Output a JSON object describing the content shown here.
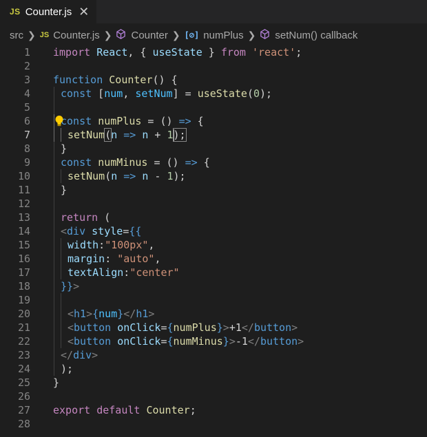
{
  "tab": {
    "badge": "JS",
    "filename": "Counter.js",
    "close": "✕"
  },
  "breadcrumb": {
    "folder": "src",
    "file_badge": "JS",
    "file": "Counter.js",
    "component": "Counter",
    "var_badge": "[⊘]",
    "variable": "numPlus",
    "callback": "setNum() callback"
  },
  "line_numbers": [
    "1",
    "2",
    "3",
    "4",
    "5",
    "6",
    "7",
    "8",
    "9",
    "10",
    "11",
    "12",
    "13",
    "14",
    "15",
    "16",
    "17",
    "18",
    "19",
    "20",
    "21",
    "22",
    "23",
    "24",
    "25",
    "26",
    "27",
    "28"
  ],
  "code": {
    "l1": [
      "import",
      " ",
      "React",
      ", { ",
      "useState",
      " } ",
      "from",
      " ",
      "'react'",
      ";"
    ],
    "l3": [
      "function",
      " ",
      "Counter",
      "() {"
    ],
    "l4": [
      "const",
      " [",
      "num",
      ", ",
      "setNum",
      "] = ",
      "useState",
      "(",
      "0",
      ");"
    ],
    "l6": [
      "const",
      " ",
      "numPlus",
      " = () ",
      "=>",
      " {"
    ],
    "l7": [
      "setNum",
      "(",
      "n",
      " ",
      "=>",
      " ",
      "n",
      " + ",
      "1",
      ");"
    ],
    "l8": [
      "}"
    ],
    "l9": [
      "const",
      " ",
      "numMinus",
      " = () ",
      "=>",
      " {"
    ],
    "l10": [
      "setNum",
      "(",
      "n",
      " ",
      "=>",
      " ",
      "n",
      " - ",
      "1",
      ");"
    ],
    "l11": [
      "}"
    ],
    "l13": [
      "return",
      " ("
    ],
    "l14": [
      "<",
      "div",
      " ",
      "style",
      "=",
      "{{"
    ],
    "l15": [
      "width",
      ":",
      "\"100px\"",
      ","
    ],
    "l16": [
      "margin",
      ": ",
      "\"auto\"",
      ","
    ],
    "l17": [
      "textAlign",
      ":",
      "\"center\""
    ],
    "l18": [
      "}}",
      ">"
    ],
    "l20": [
      "<",
      "h1",
      ">",
      "{",
      "num",
      "}",
      "</",
      "h1",
      ">"
    ],
    "l21": [
      "<",
      "button",
      " ",
      "onClick",
      "=",
      "{",
      "numPlus",
      "}",
      ">",
      "+1",
      "</",
      "button",
      ">"
    ],
    "l22": [
      "<",
      "button",
      " ",
      "onClick",
      "=",
      "{",
      "numMinus",
      "}",
      ">",
      "-1",
      "</",
      "button",
      ">"
    ],
    "l23": [
      "</",
      "div",
      ">"
    ],
    "l24": [
      ");"
    ],
    "l25": [
      "}"
    ],
    "l27": [
      "export",
      " ",
      "default",
      " ",
      "Counter",
      ";"
    ]
  }
}
